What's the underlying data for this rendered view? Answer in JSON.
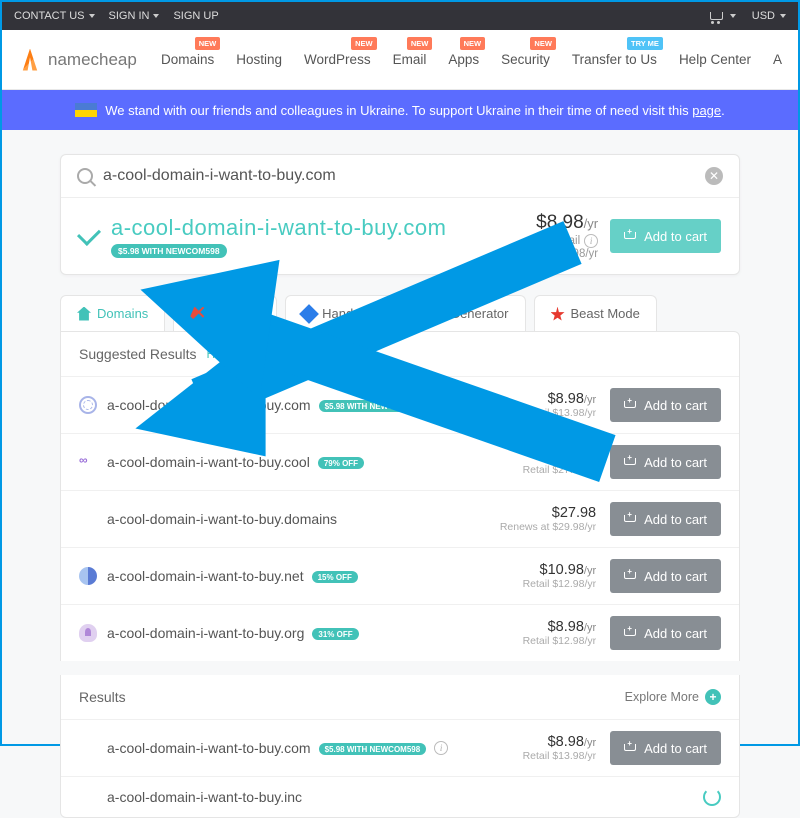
{
  "topbar": {
    "contact": "CONTACT US",
    "signin": "SIGN IN",
    "signup": "SIGN UP",
    "currency": "USD"
  },
  "nav": {
    "items": [
      {
        "label": "Domains",
        "tag": "NEW",
        "tagClass": "new"
      },
      {
        "label": "Hosting"
      },
      {
        "label": "WordPress",
        "tag": "NEW",
        "tagClass": "new"
      },
      {
        "label": "Email",
        "tag": "NEW",
        "tagClass": "new"
      },
      {
        "label": "Apps",
        "tag": "NEW",
        "tagClass": "new"
      },
      {
        "label": "Security",
        "tag": "NEW",
        "tagClass": "new"
      },
      {
        "label": "Transfer to Us",
        "tag": "TRY ME",
        "tagClass": "try"
      },
      {
        "label": "Help Center"
      },
      {
        "label": "A"
      }
    ]
  },
  "logo": "namecheap",
  "banner": {
    "text": "We stand with our friends and colleagues in Ukraine. To support Ukraine in their time of need visit this ",
    "link": "page"
  },
  "search": {
    "value": "a-cool-domain-i-want-to-buy.com"
  },
  "hero": {
    "domain": "a-cool-domain-i-want-to-buy.com",
    "promo": "$5.98 WITH NEWCOM598",
    "price": "$8.98",
    "unit": "/yr",
    "retail_label": "Retail",
    "retail": "$13.98/yr",
    "btn": "Add to cart"
  },
  "tabs": [
    "Domains",
    "Auctions",
    "Handshake",
    "Generator",
    "Beast Mode"
  ],
  "suggested": {
    "title": "Suggested Results",
    "hide": "Hide",
    "items": [
      {
        "ico": "globe",
        "domain": "a-cool-domain-i-want-to-buy.com",
        "badge": "$5.98 WITH NEWCOM598",
        "info": true,
        "price": "$8.98",
        "unit": "/yr",
        "sub": "Retail $13.98/yr"
      },
      {
        "ico": "cool",
        "domain": "a-cool-domain-i-want-to-buy.cool",
        "badge": "79% OFF",
        "price": "$5.98",
        "unit": "/yr",
        "sub": "Retail $27.98/yr"
      },
      {
        "ico": "",
        "domain": "a-cool-domain-i-want-to-buy.domains",
        "price": "$27.98",
        "unit": "",
        "sub": "Renews at $29.98/yr"
      },
      {
        "ico": "net",
        "domain": "a-cool-domain-i-want-to-buy.net",
        "badge": "15% OFF",
        "price": "$10.98",
        "unit": "/yr",
        "sub": "Retail $12.98/yr"
      },
      {
        "ico": "org",
        "domain": "a-cool-domain-i-want-to-buy.org",
        "badge": "31% OFF",
        "price": "$8.98",
        "unit": "/yr",
        "sub": "Retail $12.98/yr"
      }
    ]
  },
  "results": {
    "title": "Results",
    "explore": "Explore More",
    "items": [
      {
        "domain": "a-cool-domain-i-want-to-buy.com",
        "badge": "$5.98 WITH NEWCOM598",
        "info": true,
        "price": "$8.98",
        "unit": "/yr",
        "sub": "Retail $13.98/yr"
      },
      {
        "domain": "a-cool-domain-i-want-to-buy.inc",
        "loading": true
      }
    ]
  },
  "addToCart": "Add to cart"
}
